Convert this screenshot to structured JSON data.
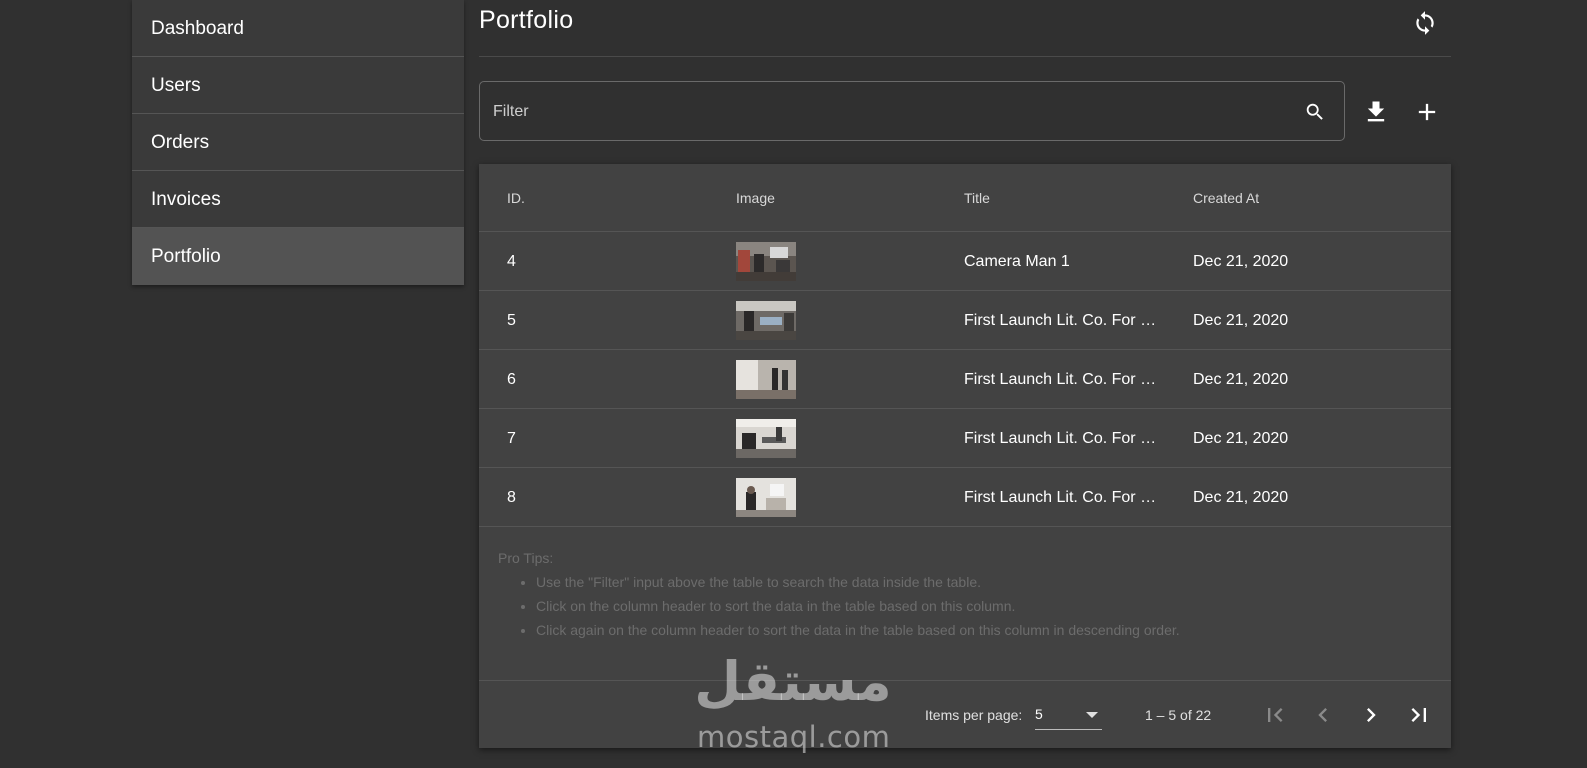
{
  "sidebar": {
    "items": [
      {
        "label": "Dashboard"
      },
      {
        "label": "Users"
      },
      {
        "label": "Orders"
      },
      {
        "label": "Invoices"
      },
      {
        "label": "Portfolio",
        "active": true
      }
    ]
  },
  "header": {
    "title": "Portfolio",
    "refresh_icon": "refresh-icon"
  },
  "filter": {
    "placeholder": "Filter",
    "search_icon": "search-icon",
    "download_icon": "download-icon",
    "add_icon": "add-icon"
  },
  "table": {
    "columns": [
      "ID.",
      "Image",
      "Title",
      "Created At"
    ],
    "rows": [
      {
        "id": "4",
        "title": "Camera Man 1",
        "created": "Dec 21, 2020"
      },
      {
        "id": "5",
        "title": "First Launch Lit. Co. For …",
        "created": "Dec 21, 2020"
      },
      {
        "id": "6",
        "title": "First Launch Lit. Co. For …",
        "created": "Dec 21, 2020"
      },
      {
        "id": "7",
        "title": "First Launch Lit. Co. For …",
        "created": "Dec 21, 2020"
      },
      {
        "id": "8",
        "title": "First Launch Lit. Co. For …",
        "created": "Dec 21, 2020"
      }
    ]
  },
  "tips": {
    "heading": "Pro Tips:",
    "items": [
      "Use the \"Filter\" input above the table to search the data inside the table.",
      "Click on the column header to sort the data in the table based on this column.",
      "Click again on the column header to sort the data in the table based on this column in descending order."
    ]
  },
  "paginator": {
    "items_per_page_label": "Items per page:",
    "items_per_page_value": "5",
    "range_label": "1 – 5 of 22"
  },
  "watermark": {
    "arabic": "مستقل",
    "latin": "mostaql.com"
  },
  "colors": {
    "background": "#303030",
    "card": "#424242",
    "active_nav": "#535353"
  }
}
